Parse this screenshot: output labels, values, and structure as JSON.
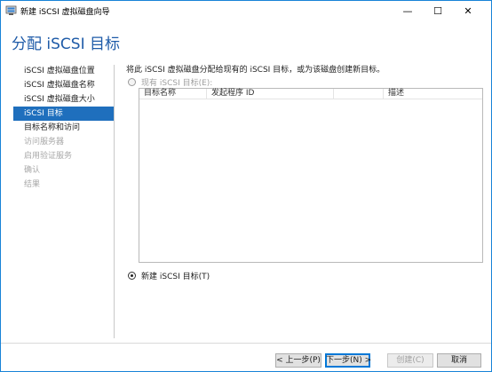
{
  "window": {
    "title": "新建 iSCSI 虚拟磁盘向导",
    "minimize_glyph": "—",
    "maximize_glyph": "☐",
    "close_glyph": "✕"
  },
  "page": {
    "title": "分配 iSCSI 目标"
  },
  "nav": {
    "items": [
      {
        "label": "iSCSI 虚拟磁盘位置",
        "state": "normal"
      },
      {
        "label": "iSCSI 虚拟磁盘名称",
        "state": "normal"
      },
      {
        "label": "iSCSI 虚拟磁盘大小",
        "state": "normal"
      },
      {
        "label": "iSCSI 目标",
        "state": "active"
      },
      {
        "label": "目标名称和访问",
        "state": "normal"
      },
      {
        "label": "访问服务器",
        "state": "disabled"
      },
      {
        "label": "启用验证服务",
        "state": "disabled"
      },
      {
        "label": "确认",
        "state": "disabled"
      },
      {
        "label": "结果",
        "state": "disabled"
      }
    ]
  },
  "content": {
    "description": "将此 iSCSI 虚拟磁盘分配给现有的 iSCSI 目标，或为该磁盘创建新目标。",
    "existing_target_label": "现有 iSCSI 目标(E):",
    "new_target_label": "新建 iSCSI 目标(T)",
    "table": {
      "columns": [
        "目标名称",
        "发起程序 ID",
        "",
        "描述"
      ],
      "rows": []
    }
  },
  "buttons": {
    "previous": "< 上一步(P)",
    "next": "下一步(N) >",
    "create": "创建(C)",
    "cancel": "取消"
  }
}
